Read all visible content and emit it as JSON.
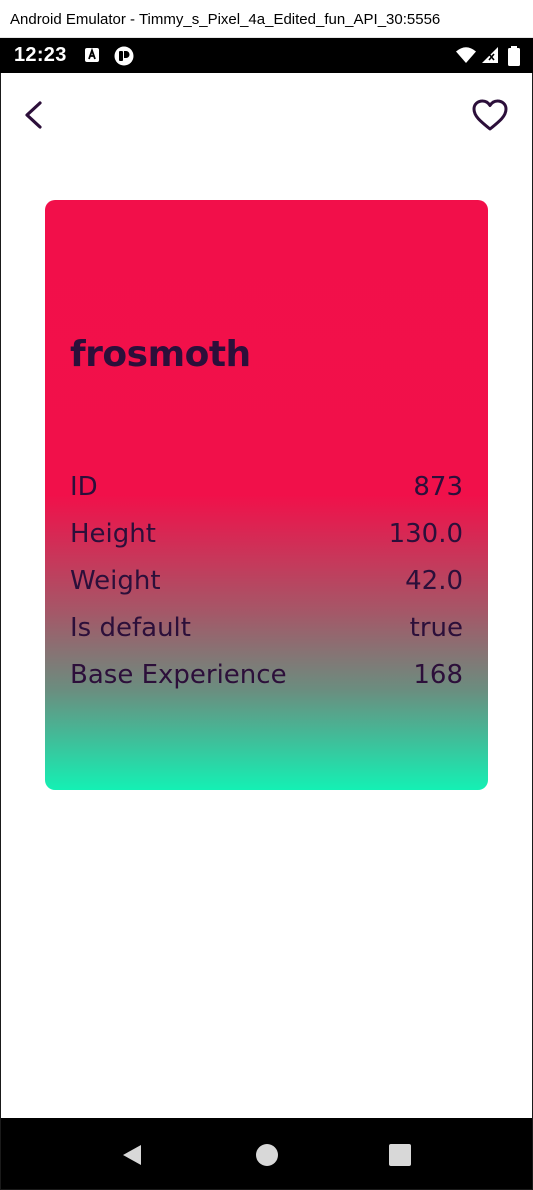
{
  "window": {
    "title": "Android Emulator - Timmy_s_Pixel_4a_Edited_fun_API_30:5556"
  },
  "status_bar": {
    "time": "12:23",
    "icons": [
      "a-letter-notification-icon",
      "app-notification-icon",
      "wifi-icon",
      "signal-icon",
      "battery-icon"
    ]
  },
  "app_bar": {
    "back_icon": "chevron-left-icon",
    "favorite_icon": "heart-outline-icon"
  },
  "card": {
    "title": "frosmoth",
    "stats": [
      {
        "label": "ID",
        "value": "873"
      },
      {
        "label": "Height",
        "value": "130.0"
      },
      {
        "label": "Weight",
        "value": "42.0"
      },
      {
        "label": "Is default",
        "value": "true"
      },
      {
        "label": "Base Experience",
        "value": "168"
      }
    ],
    "gradient": {
      "top": "#f20f4a",
      "bottom": "#14f0b4"
    },
    "text_color": "#2c0f3a"
  },
  "nav_bar": {
    "buttons": [
      "back-triangle-icon",
      "home-circle-icon",
      "recents-square-icon"
    ]
  }
}
